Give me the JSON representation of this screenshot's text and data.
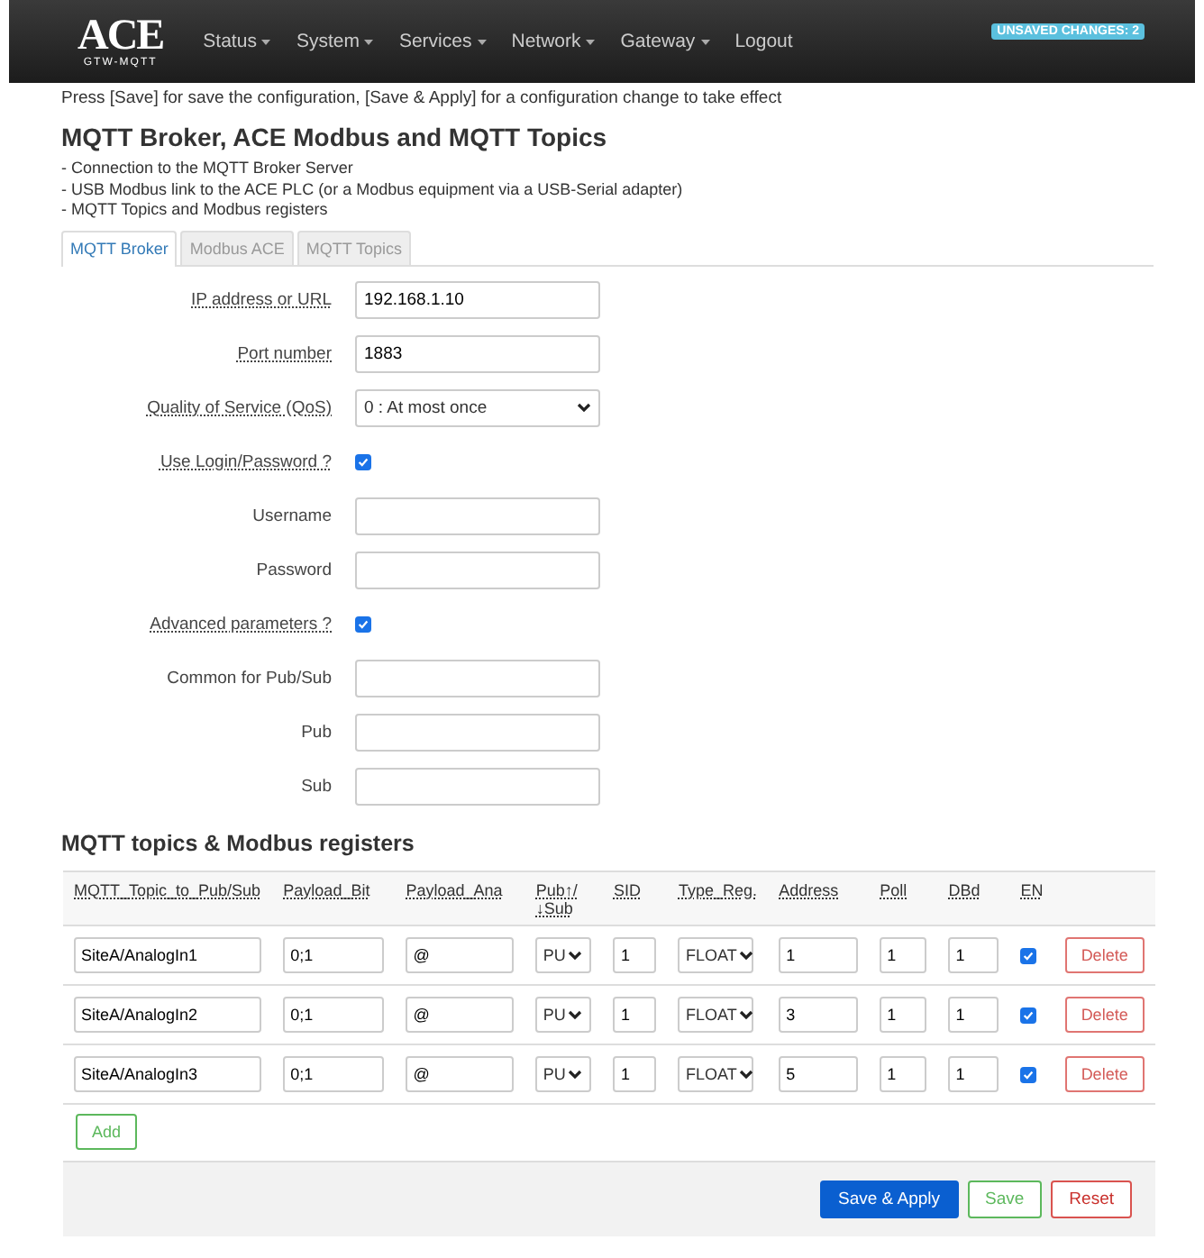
{
  "navbar": {
    "logo": {
      "title": "ACE",
      "subtitle": "GTW-MQTT"
    },
    "menu": [
      {
        "label": "Status",
        "dropdown": true
      },
      {
        "label": "System",
        "dropdown": true
      },
      {
        "label": "Services",
        "dropdown": true
      },
      {
        "label": "Network",
        "dropdown": true
      },
      {
        "label": "Gateway",
        "dropdown": true
      },
      {
        "label": "Logout",
        "dropdown": false
      }
    ],
    "badge": "UNSAVED CHANGES: 2"
  },
  "notice": "Press [Save] for save the configuration, [Save & Apply] for a configuration change to take effect",
  "page_title": "MQTT Broker, ACE Modbus and MQTT Topics",
  "description": [
    "- Connection to the MQTT Broker Server",
    "- USB Modbus link to the ACE PLC (or a Modbus equipment via a USB-Serial adapter)",
    "- MQTT Topics and Modbus registers"
  ],
  "tabs": [
    {
      "label": "MQTT Broker",
      "selected": true
    },
    {
      "label": "Modbus ACE",
      "selected": false
    },
    {
      "label": "MQTT Topics",
      "selected": false
    }
  ],
  "form": [
    {
      "kind": "text",
      "label": "IP address or URL",
      "hint": true,
      "value": "192.168.1.10"
    },
    {
      "kind": "text",
      "label": "Port number",
      "hint": true,
      "value": "1883"
    },
    {
      "kind": "select",
      "label": "Quality of Service (QoS)",
      "hint": true,
      "value": "0 : At most once"
    },
    {
      "kind": "checkbox",
      "label": "Use Login/Password ?",
      "hint": true,
      "checked": true
    },
    {
      "kind": "text",
      "label": "Username",
      "hint": false
    },
    {
      "kind": "password",
      "label": "Password",
      "hint": false
    },
    {
      "kind": "checkbox",
      "label": "Advanced parameters ?",
      "hint": true,
      "checked": true
    },
    {
      "kind": "text",
      "label": "Common for Pub/Sub",
      "hint": false
    },
    {
      "kind": "text",
      "label": "Pub",
      "hint": false
    },
    {
      "kind": "text",
      "label": "Sub",
      "hint": false
    }
  ],
  "topics": {
    "title": "MQTT topics & Modbus registers",
    "columns": [
      "MQTT_Topic_to_Pub/Sub",
      "Payload_Bit",
      "Payload_Ana",
      "Pub↑/\n↓Sub",
      "SID",
      "Type_Reg.",
      "Address",
      "Poll",
      "DBd",
      "EN"
    ],
    "rows": [
      {
        "topic": "SiteA/AnalogIn1",
        "payload_bit": "0;1",
        "payload_ana": "@",
        "pub_sub": "PU",
        "sid": "1",
        "type_reg": "FLOAT",
        "address": "1",
        "poll": "1",
        "dbd": "1",
        "enabled": true,
        "delete": "Delete"
      },
      {
        "topic": "SiteA/AnalogIn2",
        "payload_bit": "0;1",
        "payload_ana": "@",
        "pub_sub": "PU",
        "sid": "1",
        "type_reg": "FLOAT",
        "address": "3",
        "poll": "1",
        "dbd": "1",
        "enabled": true,
        "delete": "Delete"
      },
      {
        "topic": "SiteA/AnalogIn3",
        "payload_bit": "0;1",
        "payload_ana": "@",
        "pub_sub": "PU",
        "sid": "1",
        "type_reg": "FLOAT",
        "address": "5",
        "poll": "1",
        "dbd": "1",
        "enabled": true,
        "delete": "Delete"
      }
    ],
    "add": "Add"
  },
  "actions": [
    {
      "kind": "primary",
      "label": "Save & Apply"
    },
    {
      "kind": "positive",
      "label": "Save"
    },
    {
      "kind": "reset",
      "label": "Reset"
    }
  ]
}
